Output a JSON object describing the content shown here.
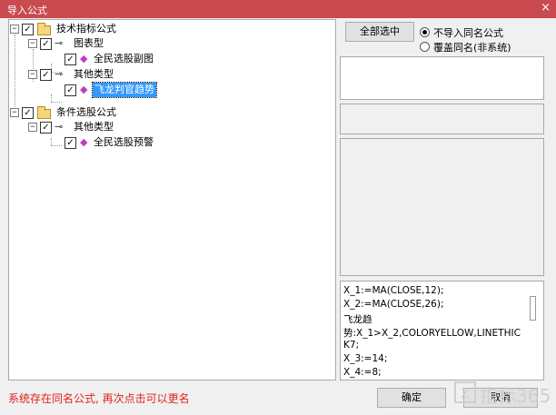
{
  "dialog": {
    "title": "导入公式",
    "close_glyph": "×"
  },
  "tree": {
    "nodes": [
      {
        "id": "n1",
        "label": "技术指标公式",
        "icon": "folder-icon",
        "checked": true,
        "expanded": true
      },
      {
        "id": "n2",
        "label": "图表型",
        "icon": "key-icon",
        "checked": true,
        "expanded": true
      },
      {
        "id": "n3",
        "label": "全民选股副图",
        "icon": "formula-icon",
        "checked": true
      },
      {
        "id": "n4",
        "label": "其他类型",
        "icon": "key-icon",
        "checked": true,
        "expanded": true
      },
      {
        "id": "n5",
        "label": "飞龙判官趋势",
        "icon": "formula-icon",
        "checked": true,
        "selected": true
      },
      {
        "id": "n6",
        "label": "条件选股公式",
        "icon": "folder-icon",
        "checked": true,
        "expanded": true
      },
      {
        "id": "n7",
        "label": "其他类型",
        "icon": "key-icon",
        "checked": true,
        "expanded": true
      },
      {
        "id": "n8",
        "label": "全民选股预警",
        "icon": "formula-icon",
        "checked": true
      }
    ],
    "expander_glyph": "−",
    "check_glyph": "✓",
    "key_glyph": "⊸",
    "gem_glyph": "◆"
  },
  "options": {
    "select_all_label": "全部选中",
    "radio_no_import": "不导入同名公式",
    "radio_overwrite": "覆盖同名(非系统)",
    "selected_radio": "no_import"
  },
  "code": {
    "lines": [
      "X_1:=MA(CLOSE,12);",
      "X_2:=MA(CLOSE,26);",
      "飞龙趋",
      "势:X_1>X_2,COLORYELLOW,LINETHIC",
      "K7;",
      "X_3:=14;",
      "X_4:=8;"
    ]
  },
  "footer": {
    "status": "系统存在同名公式, 再次点击可以更名",
    "ok_label": "确定",
    "cancel_label": "取消"
  },
  "watermark": {
    "logo_letter": "Z",
    "text": "指标365"
  },
  "colors": {
    "titlebar": "#c94a4f",
    "status_text": "#e2231a",
    "selection": "#3399ff"
  }
}
